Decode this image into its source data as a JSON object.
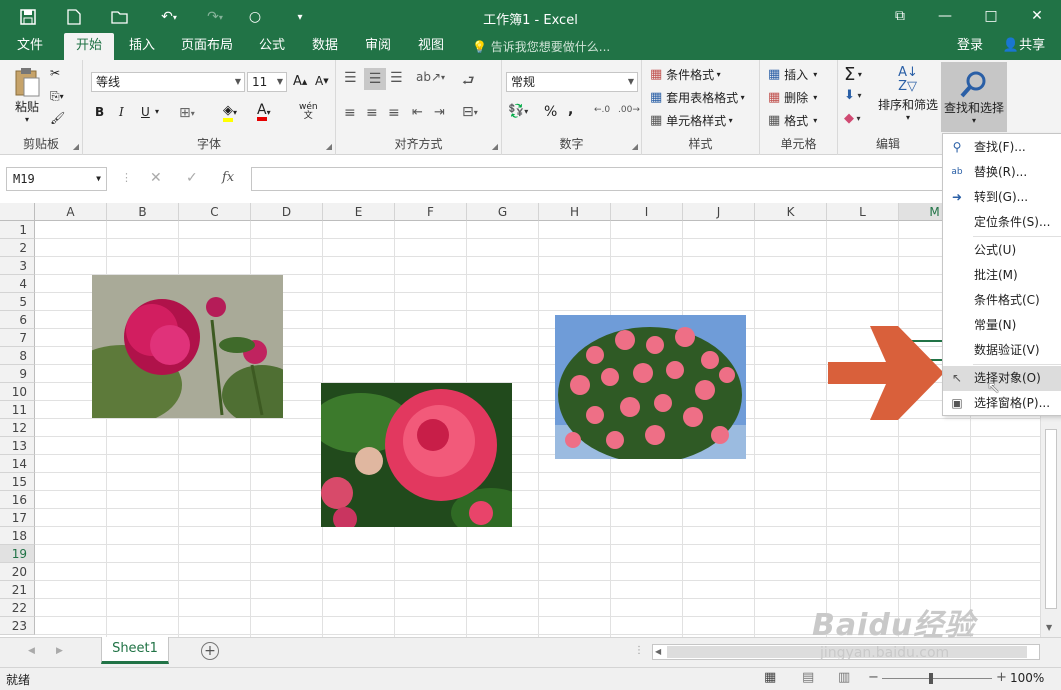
{
  "window": {
    "title": "工作簿1 - Excel",
    "login": "登录",
    "share": "共享"
  },
  "tabs": [
    {
      "label": "文件"
    },
    {
      "label": "开始"
    },
    {
      "label": "插入"
    },
    {
      "label": "页面布局"
    },
    {
      "label": "公式"
    },
    {
      "label": "数据"
    },
    {
      "label": "审阅"
    },
    {
      "label": "视图"
    }
  ],
  "tellme": "告诉我您想要做什么...",
  "ribbon": {
    "clipboard": {
      "label": "剪贴板",
      "paste": "粘贴"
    },
    "font": {
      "label": "字体",
      "name": "等线",
      "size": "11",
      "bold": "B",
      "italic": "I",
      "underline": "U"
    },
    "align": {
      "label": "对齐方式"
    },
    "number": {
      "label": "数字",
      "format": "常规",
      "percent": "%",
      "comma": ","
    },
    "styles": {
      "label": "样式",
      "cond": "条件格式",
      "table": "套用表格格式",
      "cell": "单元格样式"
    },
    "cells": {
      "label": "单元格",
      "insert": "插入",
      "delete": "删除",
      "format": "格式"
    },
    "editing": {
      "label": "编辑",
      "sort": "排序和筛选",
      "find": "查找和选择"
    }
  },
  "formula_bar": {
    "namebox": "M19",
    "fx": "fx"
  },
  "columns": [
    "A",
    "B",
    "C",
    "D",
    "E",
    "F",
    "G",
    "H",
    "I",
    "J",
    "K",
    "L",
    "M"
  ],
  "rows": [
    "1",
    "2",
    "3",
    "4",
    "5",
    "6",
    "7",
    "8",
    "9",
    "10",
    "11",
    "12",
    "13",
    "14",
    "15",
    "16",
    "17",
    "18",
    "19",
    "20",
    "21",
    "22",
    "23"
  ],
  "selected_row": "19",
  "menu": [
    {
      "label": "查找(F)...",
      "icon": "search-icon"
    },
    {
      "label": "替换(R)...",
      "icon": "replace-icon"
    },
    {
      "label": "转到(G)...",
      "icon": "arrow-right-icon"
    },
    {
      "label": "定位条件(S)...",
      "icon": ""
    },
    {
      "label": "公式(U)",
      "icon": ""
    },
    {
      "label": "批注(M)",
      "icon": ""
    },
    {
      "label": "条件格式(C)",
      "icon": ""
    },
    {
      "label": "常量(N)",
      "icon": ""
    },
    {
      "label": "数据验证(V)",
      "icon": ""
    },
    {
      "label": "选择对象(O)",
      "icon": "cursor-icon"
    },
    {
      "label": "选择窗格(P)...",
      "icon": "selection-pane-icon"
    }
  ],
  "sheet_tab": "Sheet1",
  "status": {
    "ready": "就绪",
    "zoom": "100%"
  },
  "watermark": {
    "brand": "Baidu经验",
    "url": "jingyan.baidu.com"
  },
  "colors": {
    "accent": "#217346",
    "arrow": "#d9603b"
  }
}
